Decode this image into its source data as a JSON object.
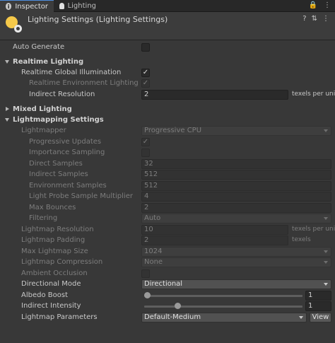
{
  "tabs": [
    {
      "label": "Inspector",
      "icon": "info-icon",
      "active": true
    },
    {
      "label": "Lighting",
      "icon": "bulb-icon",
      "active": false
    }
  ],
  "tab_actions": {
    "lock": "🔒",
    "menu": "⋮"
  },
  "header": {
    "title": "Lighting Settings (Lighting Settings)",
    "help": "?",
    "preset": "⇅",
    "more": "⋮"
  },
  "auto_generate": {
    "label": "Auto Generate",
    "checked": false
  },
  "realtime": {
    "title": "Realtime Lighting",
    "gi_label": "Realtime Global Illumination",
    "gi_checked": true,
    "env_label": "Realtime Environment Lighting",
    "env_checked": true,
    "indirect_res_label": "Indirect Resolution",
    "indirect_res_value": "2",
    "indirect_res_suffix": "texels per unit"
  },
  "mixed": {
    "title": "Mixed Lighting"
  },
  "lightmapping": {
    "title": "Lightmapping Settings",
    "lightmapper_label": "Lightmapper",
    "lightmapper_value": "Progressive CPU",
    "progressive_updates_label": "Progressive Updates",
    "progressive_updates_checked": true,
    "importance_sampling_label": "Importance Sampling",
    "importance_sampling_checked": false,
    "direct_samples_label": "Direct Samples",
    "direct_samples_value": "32",
    "indirect_samples_label": "Indirect Samples",
    "indirect_samples_value": "512",
    "environment_samples_label": "Environment Samples",
    "environment_samples_value": "512",
    "light_probe_label": "Light Probe Sample Multiplier",
    "light_probe_value": "4",
    "max_bounces_label": "Max Bounces",
    "max_bounces_value": "2",
    "filtering_label": "Filtering",
    "filtering_value": "Auto",
    "resolution_label": "Lightmap Resolution",
    "resolution_value": "10",
    "resolution_suffix": "texels per unit",
    "padding_label": "Lightmap Padding",
    "padding_value": "2",
    "padding_suffix": "texels",
    "max_size_label": "Max Lightmap Size",
    "max_size_value": "1024",
    "compression_label": "Lightmap Compression",
    "compression_value": "None",
    "ao_label": "Ambient Occlusion",
    "ao_checked": false,
    "directional_label": "Directional Mode",
    "directional_value": "Directional",
    "albedo_label": "Albedo Boost",
    "albedo_value": "1",
    "albedo_fraction": 0.0,
    "indirect_label": "Indirect Intensity",
    "indirect_value": "1",
    "indirect_fraction": 0.2,
    "params_label": "Lightmap Parameters",
    "params_value": "Default-Medium",
    "view_label": "View"
  }
}
